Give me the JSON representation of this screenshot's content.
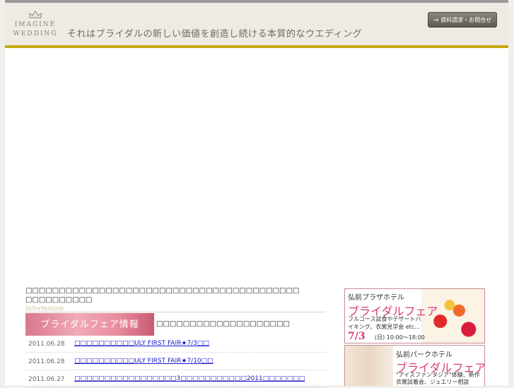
{
  "header": {
    "logo_line1": "IMAGINE",
    "logo_line2": "WEDDING",
    "tagline": "それはブライダルの新しい価値を創造し続ける本質的なウエディング",
    "contact_button": "資料請求・お問合せ",
    "contact_arrow": "→"
  },
  "main": {
    "intro_text": "□□□□□□□□□□□□□□□□□□□□□□□□□□□□□□□□□□□□□□□□□□□□□□□□□□□",
    "info_label": "Information",
    "fair_banner": "ブライダルフェア情報",
    "fair_description": "□□□□□□□□□□□□□□□□□□□□",
    "news": [
      {
        "date": "2011.06.28",
        "title": "□□□□□□□□□□ULY FIRST FAIR★7/3□□"
      },
      {
        "date": "2011.06.28",
        "title": "□□□□□□□□□□ULY FIRST FAIR★7/10□□"
      },
      {
        "date": "2011.06.27",
        "title": "□□□□□□□□□□□□□□□□□3□□□□□□□□□□□2011□□□□□□□"
      }
    ]
  },
  "sidebar": {
    "ad1": {
      "hotel": "弘前プラザホテル",
      "title": "ブライダルフェア",
      "description": "フルコース試食やデザートバイキング、衣裳見学会 etc...",
      "date": "7/3",
      "time": "(日) 10:00～18:00"
    },
    "ad2": {
      "hotel": "弘前パークホテル",
      "title": "ブライダルフェア",
      "description": "\"アイスファンタジア\"体験、新作衣裳試着会、ジュエリー相談 etc..."
    }
  },
  "colors": {
    "header_bg": "#efeae3",
    "gold_line": "#c4aa12",
    "link": "#1a1acc",
    "accent_pink": "#d83a78"
  }
}
